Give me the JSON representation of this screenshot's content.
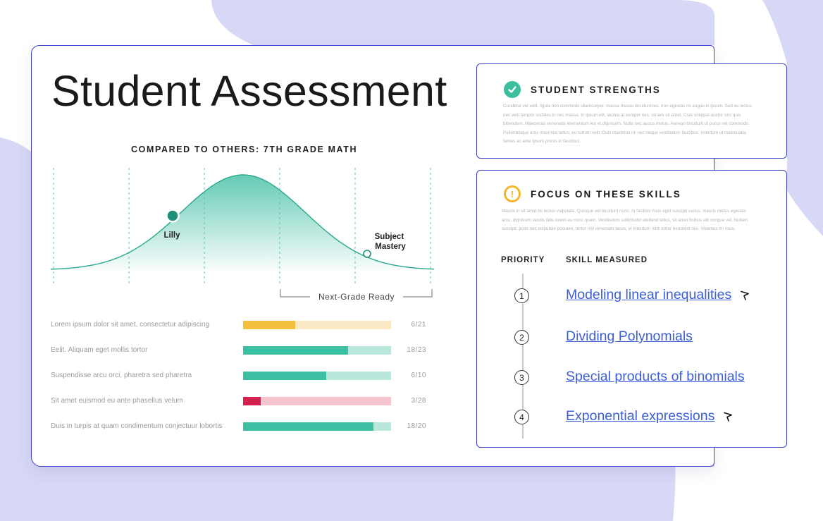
{
  "title": "Student Assessment",
  "comparison": {
    "title": "COMPARED TO OTHERS: 7TH GRADE MATH",
    "markers": {
      "student": "Lilly",
      "mastery": "Subject\nMastery"
    },
    "bracket_label": "Next-Grade Ready"
  },
  "bars": [
    {
      "label": "Lorem ipsum dolor sit amet, consectetur adipiscing",
      "count": "6/21",
      "fill": 0.35,
      "color": "#f4bf3a",
      "track": "#fbe8c4"
    },
    {
      "label": "Eelit. Aliquam eget mollis tortor",
      "count": "18/23",
      "fill": 0.71,
      "color": "#3dbfa3",
      "track": "#b9e7dc"
    },
    {
      "label": "Suspendisse arcu orci, pharetra sed pharetra",
      "count": "6/10",
      "fill": 0.56,
      "color": "#3dbfa3",
      "track": "#b9e7dc"
    },
    {
      "label": "Sit amet euismod eu ante phasellus velum",
      "count": "3/28",
      "fill": 0.12,
      "color": "#d5204d",
      "track": "#f6c4cf"
    },
    {
      "label": "Duis in turpis at quam condimentum conjectuur lobortis",
      "count": "18/20",
      "fill": 0.88,
      "color": "#3dbfa3",
      "track": "#b9e7dc"
    }
  ],
  "strengths": {
    "title": "STUDENT STRENGTHS",
    "body": "Curabitur vel velit, ligula non commodo ullamcorper, massa massa tincidunt leo, non egestas mi augue in ipsum. Sed eu lectus nec velit tempor sodales in nec massa. In ipsum elit, lacinia at semper nec, ornare sit amet. Cras volutpat auctor orci quis bibendum. Maecenas venenatis elementum leo et dignissim. Nulla nec aucus metus. Aenean tincidunt ut purus vel commodo. Pellentesque eros maximus tellus, eu rutrum velit. Duis maximus mi nec neque vestibulum faucibus. Interdum et malesuada fames ac ante ipsum primis in faucibus."
  },
  "focus": {
    "title": "FOCUS ON THESE SKILLS",
    "body": "Mauris in sit amet mi lectus vulputate. Quisque vel tincidunt nunc. In facilisis risus eget suscipit varius, mauris metus egestas arcu, dignissim iaculis felis lorem eu nunc quam. Vestibulum sollicitudin eleifend tellus, sit amet finibus elit congue vel. Nullam suscipit, justo nec vulputate posuere, tortor nisl venenatis lacus, et interdum nibh tortor hendrerit nisi. Vivamus mi risus.",
    "col_priority": "PRIORITY",
    "col_skill": "SKILL MEASURED",
    "skills": [
      {
        "num": "1",
        "label": "Modeling linear inequalities",
        "flagged": true
      },
      {
        "num": "2",
        "label": "Dividing Polynomials",
        "flagged": false
      },
      {
        "num": "3",
        "label": "Special products of binomials",
        "flagged": false
      },
      {
        "num": "4",
        "label": "Exponential expressions",
        "flagged": true
      }
    ]
  },
  "colors": {
    "accent_border": "#3f43c9",
    "bg_blob": "#d7d8f6",
    "teal": "#3dbfa3",
    "link": "#3d5fd6"
  }
}
